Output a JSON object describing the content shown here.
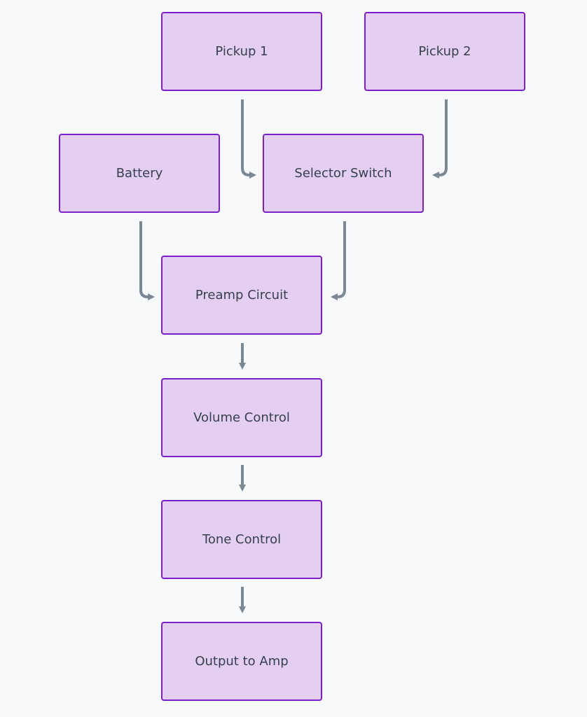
{
  "diagram": {
    "type": "flowchart",
    "nodes": [
      {
        "id": "pickup1",
        "label": "Pickup 1"
      },
      {
        "id": "pickup2",
        "label": "Pickup 2"
      },
      {
        "id": "battery",
        "label": "Battery"
      },
      {
        "id": "selector",
        "label": "Selector Switch"
      },
      {
        "id": "preamp",
        "label": "Preamp Circuit"
      },
      {
        "id": "volume",
        "label": "Volume Control"
      },
      {
        "id": "tone",
        "label": "Tone Control"
      },
      {
        "id": "output",
        "label": "Output to Amp"
      }
    ],
    "edges": [
      {
        "from": "pickup1",
        "to": "selector"
      },
      {
        "from": "pickup2",
        "to": "selector"
      },
      {
        "from": "battery",
        "to": "preamp"
      },
      {
        "from": "selector",
        "to": "preamp"
      },
      {
        "from": "preamp",
        "to": "volume"
      },
      {
        "from": "volume",
        "to": "tone"
      },
      {
        "from": "tone",
        "to": "output"
      }
    ],
    "colors": {
      "node_fill": "#e4cff3",
      "node_border": "#7d1fc9",
      "edge": "#7a8795",
      "text": "#37404d",
      "background": "#f8f9fa"
    }
  }
}
